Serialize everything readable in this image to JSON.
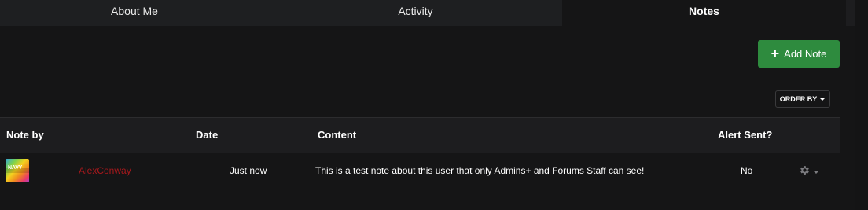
{
  "tabs": [
    {
      "label": "About Me",
      "active": false
    },
    {
      "label": "Activity",
      "active": false
    },
    {
      "label": "Notes",
      "active": true
    }
  ],
  "toolbar": {
    "add_note_label": "Add Note",
    "order_by_label": "ORDER BY"
  },
  "table": {
    "headers": {
      "note_by": "Note by",
      "date": "Date",
      "content": "Content",
      "alert_sent": "Alert Sent?"
    },
    "rows": [
      {
        "avatar_icon": "navy-avatar",
        "avatar_text": "NAVY",
        "user": "AlexConway",
        "date": "Just now",
        "content": "This is a test note about this user that only Admins+ and Forums Staff can see!",
        "alert_sent": "No",
        "actions_icon": "gear-icon"
      }
    ]
  },
  "colors": {
    "accent_green": "#2e8b3e",
    "username_red": "#a8181c",
    "background": "#151516"
  }
}
